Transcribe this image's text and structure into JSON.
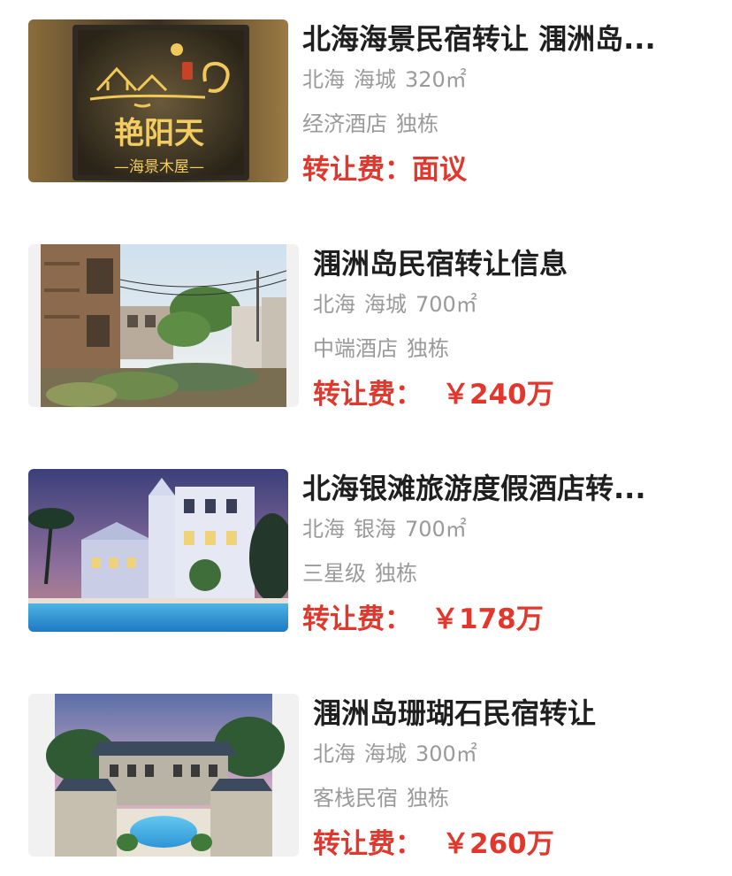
{
  "listings": [
    {
      "title": "北海海景民宿转让 涠洲岛...",
      "city": "北海",
      "district": "海城",
      "area": "320㎡",
      "category": "经济酒店",
      "building": "独栋",
      "price_label": "转让费：",
      "price_value": "面议",
      "image_text": {
        "sign_name": "艳阳天",
        "sign_sub": "—海景木屋—"
      }
    },
    {
      "title": "涠洲岛民宿转让信息",
      "city": "北海",
      "district": "海城",
      "area": "700㎡",
      "category": "中端酒店",
      "building": "独栋",
      "price_label": "转让费：",
      "price_value": "￥240万"
    },
    {
      "title": "北海银滩旅游度假酒店转...",
      "city": "北海",
      "district": "银海",
      "area": "700㎡",
      "category": "三星级",
      "building": "独栋",
      "price_label": "转让费：",
      "price_value": "￥178万"
    },
    {
      "title": "涠洲岛珊瑚石民宿转让",
      "city": "北海",
      "district": "海城",
      "area": "300㎡",
      "category": "客栈民宿",
      "building": "独栋",
      "price_label": "转让费：",
      "price_value": "￥260万"
    }
  ],
  "colors": {
    "title": "#1f1f1f",
    "meta": "#9a9a9a",
    "price": "#e1372c"
  }
}
